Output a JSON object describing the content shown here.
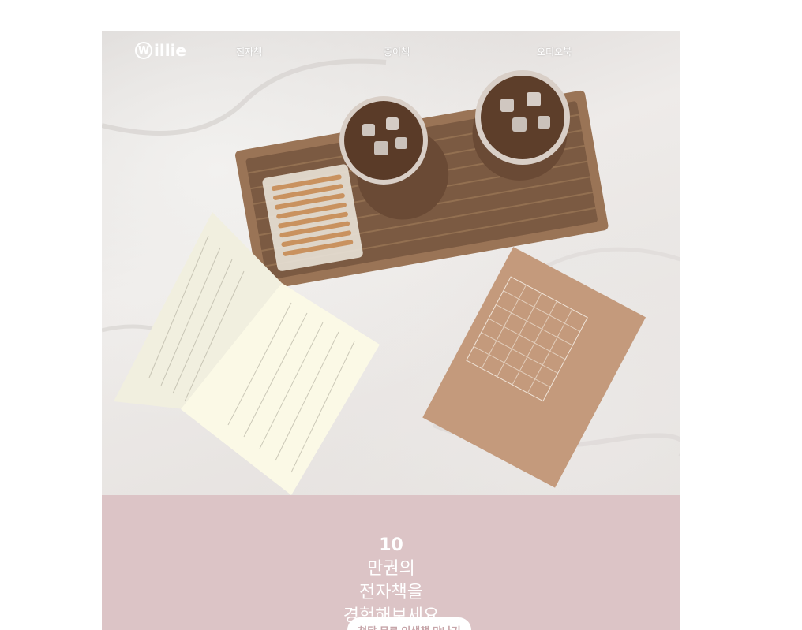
{
  "nav": {
    "logo_text": "illie",
    "logo_mark": "W",
    "items": [
      {
        "label": "전자책"
      },
      {
        "label": "종이책"
      },
      {
        "label": "오디오북"
      }
    ]
  },
  "hero": {
    "image_subject": "books-and-iced-coffee-on-bed"
  },
  "promo": {
    "headline_num": "10",
    "headline_line1_rest": "만권의",
    "headline_line2": "전자책을",
    "headline_line3": "경험해보세요",
    "cta_label": "첫달 무료 인생책 만나기",
    "background": "#dcc4c6",
    "cta_text_color": "#c7a6aa"
  }
}
